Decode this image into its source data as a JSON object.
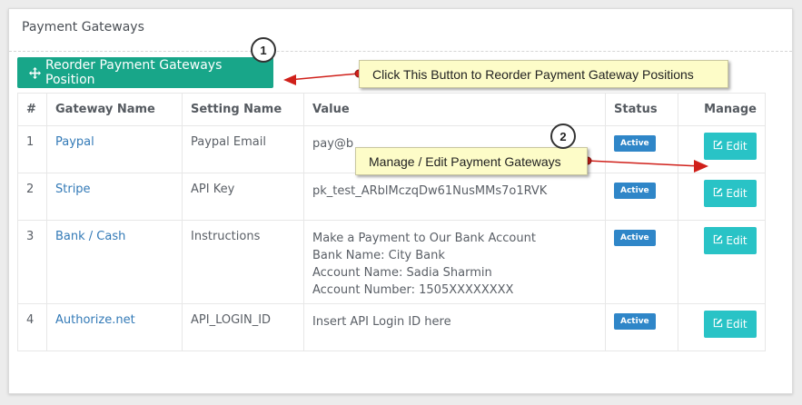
{
  "panel": {
    "title": "Payment Gateways"
  },
  "toolbar": {
    "reorder_label": "Reorder Payment Gateways Position"
  },
  "table": {
    "headers": [
      "#",
      "Gateway Name",
      "Setting Name",
      "Value",
      "Status",
      "Manage"
    ],
    "rows": [
      {
        "num": "1",
        "name": "Paypal",
        "setting": "Paypal Email",
        "value": [
          "pay@b"
        ],
        "status": "Active",
        "edit": "Edit"
      },
      {
        "num": "2",
        "name": "Stripe",
        "setting": "API Key",
        "value": [
          "pk_test_ARblMczqDw61NusMMs7o1RVK"
        ],
        "status": "Active",
        "edit": "Edit"
      },
      {
        "num": "3",
        "name": "Bank / Cash",
        "setting": "Instructions",
        "value": [
          "Make a Payment to Our Bank Account",
          "Bank Name: City Bank",
          "Account Name: Sadia Sharmin",
          "Account Number: 1505XXXXXXXX"
        ],
        "status": "Active",
        "edit": "Edit"
      },
      {
        "num": "4",
        "name": "Authorize.net",
        "setting": "API_LOGIN_ID",
        "value": [
          "Insert API Login ID here"
        ],
        "status": "Active",
        "edit": "Edit"
      }
    ]
  },
  "annotations": {
    "callout1": "Click This Button to Reorder Payment Gateway Positions",
    "callout2": "Manage / Edit Payment Gateways",
    "marker1": "1",
    "marker2": "2"
  },
  "colors": {
    "reorder_button": "#18a689",
    "edit_button": "#29c3c6",
    "badge": "#2f86c8",
    "link": "#337ab7",
    "callout_bg": "#fdfcc8",
    "arrow": "#d0201a"
  },
  "icons": {
    "reorder": "arrows-move-icon",
    "edit": "edit-icon"
  }
}
